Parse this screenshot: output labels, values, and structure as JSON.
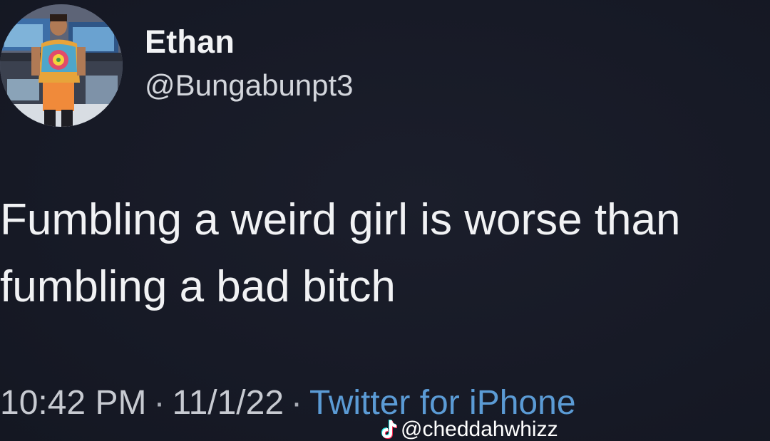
{
  "user": {
    "display_name": "Ethan",
    "handle": "@Bungabunpt3",
    "avatar_icon": "user-avatar-photo"
  },
  "tweet": {
    "lines": [
      "Fumbling a weird girl is worse than",
      "fumbling a bad bitch"
    ]
  },
  "meta": {
    "time": "10:42 PM",
    "separator": "·",
    "date": "11/1/22",
    "source": "Twitter for iPhone"
  },
  "watermark": {
    "icon": "tiktok-icon",
    "text": "@cheddahwhizz"
  },
  "colors": {
    "background": "#171a27",
    "text": "#f1f2f4",
    "link": "#5b9bd5"
  }
}
